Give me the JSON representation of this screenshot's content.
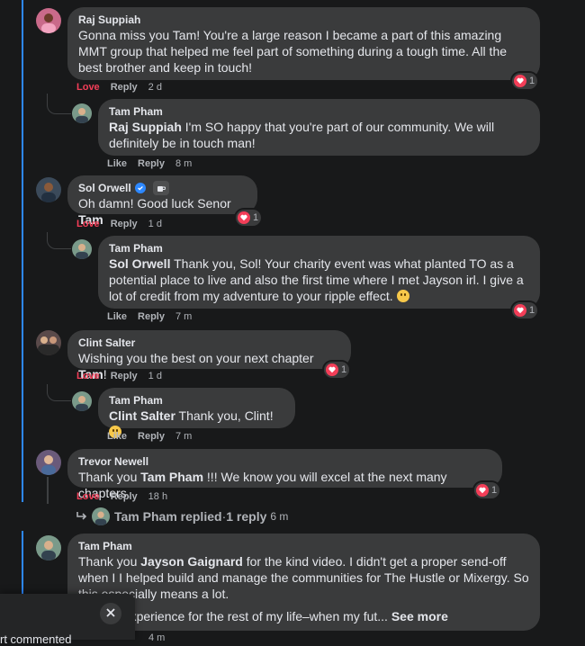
{
  "labels": {
    "love": "Love",
    "like": "Like",
    "reply": "Reply"
  },
  "comments": [
    {
      "author": "Raj Suppiah",
      "text": "Gonna miss you Tam! You're a large reason I became a part of this amazing MMT group that helped me feel part of something during a tough time. All the best brother and keep in touch!",
      "reacted": "Love",
      "time": "2 d",
      "reaction_count": "1"
    },
    {
      "author": "Tam Pham",
      "mention": "Raj Suppiah",
      "text": " I'm SO happy that you're part of our community. We will definitely be in touch man!",
      "reacted": "Like",
      "time": "8 m"
    },
    {
      "author": "Sol Orwell",
      "text_pre": "Oh damn! Good luck Senor ",
      "mention": "Tam",
      "reacted": "Love",
      "time": "1 d",
      "reaction_count": "1"
    },
    {
      "author": "Tam Pham",
      "mention": "Sol Orwell",
      "text": " Thank you, Sol! Your charity event was what planted TO as a potential place to live and also the first time where I met Jayson irl. I give a lot of credit from my adventure to your ripple effect.",
      "reacted": "Like",
      "time": "7 m",
      "reaction_count": "1"
    },
    {
      "author": "Clint Salter",
      "text_pre": "Wishing you the best on your next chapter ",
      "mention": "Tam",
      "text_post": "!",
      "reacted": "Love",
      "time": "1 d",
      "reaction_count": "1"
    },
    {
      "author": "Tam Pham",
      "mention": "Clint Salter",
      "text": " Thank you, Clint!",
      "reacted": "Like",
      "time": "7 m"
    },
    {
      "author": "Trevor Newell",
      "text_pre": "Thank you ",
      "mention": "Tam Pham",
      "text_post": " !!! We know you will excel at the next many chapters.",
      "reacted": "Love",
      "time": "18 h",
      "reaction_count": "1"
    },
    {
      "author": "Tam Pham",
      "text_pre": "Thank you ",
      "mention": "Jayson Gaignard",
      "text_post": " for the kind video. I didn't get a proper send-off when I I helped build and manage the communities for The Hustle or Mixergy. So this especially means a lot.",
      "line2": "ber this experience for the rest of my life–when my fut...",
      "see_more": "See more",
      "time": "4 m"
    }
  ],
  "replied_summary": {
    "name": "Tam Pham replied",
    "dot": " · ",
    "count": "1 reply",
    "time": "6 m"
  },
  "popup": {
    "partial_text": "rt commented"
  },
  "colors": {
    "accent": "#2d88ff",
    "love": "#f33e58",
    "bubble": "#3a3b3c",
    "background": "#18191a"
  }
}
